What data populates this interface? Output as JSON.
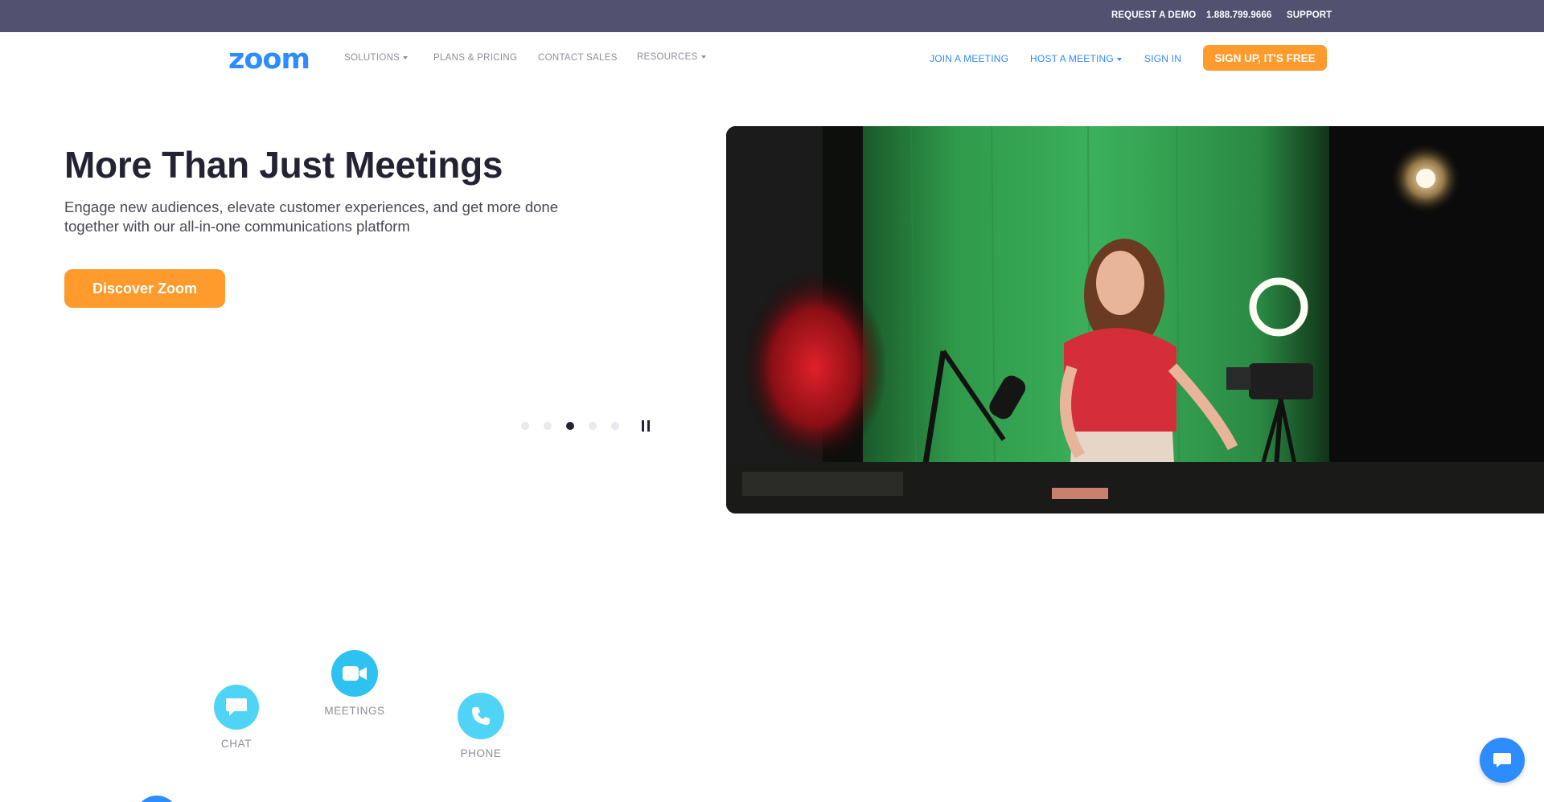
{
  "utility_bar": {
    "request_demo": "REQUEST A DEMO",
    "phone": "1.888.799.9666",
    "support": "SUPPORT"
  },
  "nav": {
    "logo": "zoom",
    "solutions": "SOLUTIONS",
    "plans_pricing": "PLANS & PRICING",
    "contact_sales": "CONTACT SALES",
    "resources": "RESOURCES",
    "join_meeting": "JOIN A MEETING",
    "host_meeting": "HOST A MEETING",
    "sign_in": "SIGN IN",
    "sign_up": "SIGN UP, IT'S FREE"
  },
  "hero": {
    "title": "More Than Just Meetings",
    "subtitle": "Engage new audiences, elevate customer experiences, and get more done together with our all-in-one communications platform",
    "cta": "Discover Zoom",
    "carousel_active_index": 2,
    "carousel_count": 5
  },
  "products": {
    "chat": "CHAT",
    "meetings": "MEETINGS",
    "phone": "PHONE"
  },
  "colors": {
    "utility_bg": "#525270",
    "brand_blue": "#2d8cff",
    "cta_orange": "#ff9a2c",
    "icon_light_blue": "#4fd4f6",
    "heading": "#232333"
  },
  "icons": {
    "chat": "speech-bubble-icon",
    "meetings": "video-camera-icon",
    "phone": "phone-handset-icon",
    "fab": "chat-bubble-icon"
  }
}
